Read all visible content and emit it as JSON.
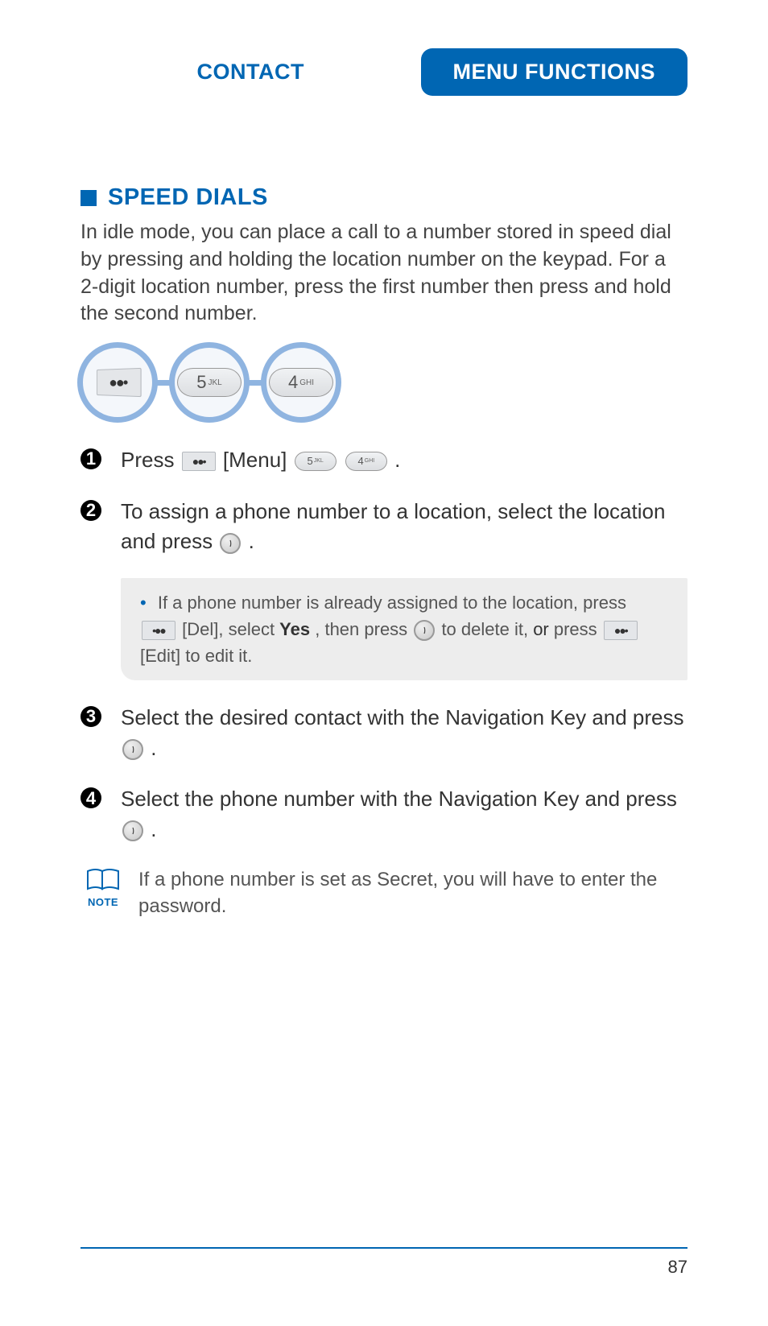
{
  "header": {
    "left": "CONTACT",
    "right": "MENU FUNCTIONS"
  },
  "section": {
    "title": "SPEED DIALS",
    "intro": "In idle mode, you can place a call to a number stored in speed dial by pressing and holding the location number on the keypad. For a 2-digit location number, press the first number then press and hold the second number."
  },
  "keypad": {
    "key1_glyph": "●●•",
    "key2_num": "5",
    "key2_sub": "JKL",
    "key3_num": "4",
    "key3_sub": "GHI"
  },
  "steps": {
    "s1_a": "Press ",
    "s1_menu_glyph": "●●•",
    "s1_b": " [Menu] ",
    "s1_key5_num": "5",
    "s1_key5_sub": "JKL",
    "s1_key4_num": "4",
    "s1_key4_sub": "GHI",
    "s1_c": ".",
    "s2_a": "To assign a phone number to a location, select the location and press ",
    "s2_b": " .",
    "s3_a": "Select the desired contact with the Navigation Key and press ",
    "s3_b": " .",
    "s4_a": "Select the phone number with the Navigation Key and press ",
    "s4_b": " ."
  },
  "subnote": {
    "a": "If a phone number is already assigned to the location, press ",
    "del_glyph": "•●●",
    "b": " [Del], select ",
    "yes": "Yes",
    "c": ", then press  ",
    "d": " to delete it, ",
    "or": "or",
    "e": " press ",
    "edit_glyph": "●●•",
    "f": " [Edit] to edit it."
  },
  "note": {
    "label": "NOTE",
    "text": "If a phone number is set as Secret, you will have to enter the password."
  },
  "footer": {
    "page": "87"
  }
}
